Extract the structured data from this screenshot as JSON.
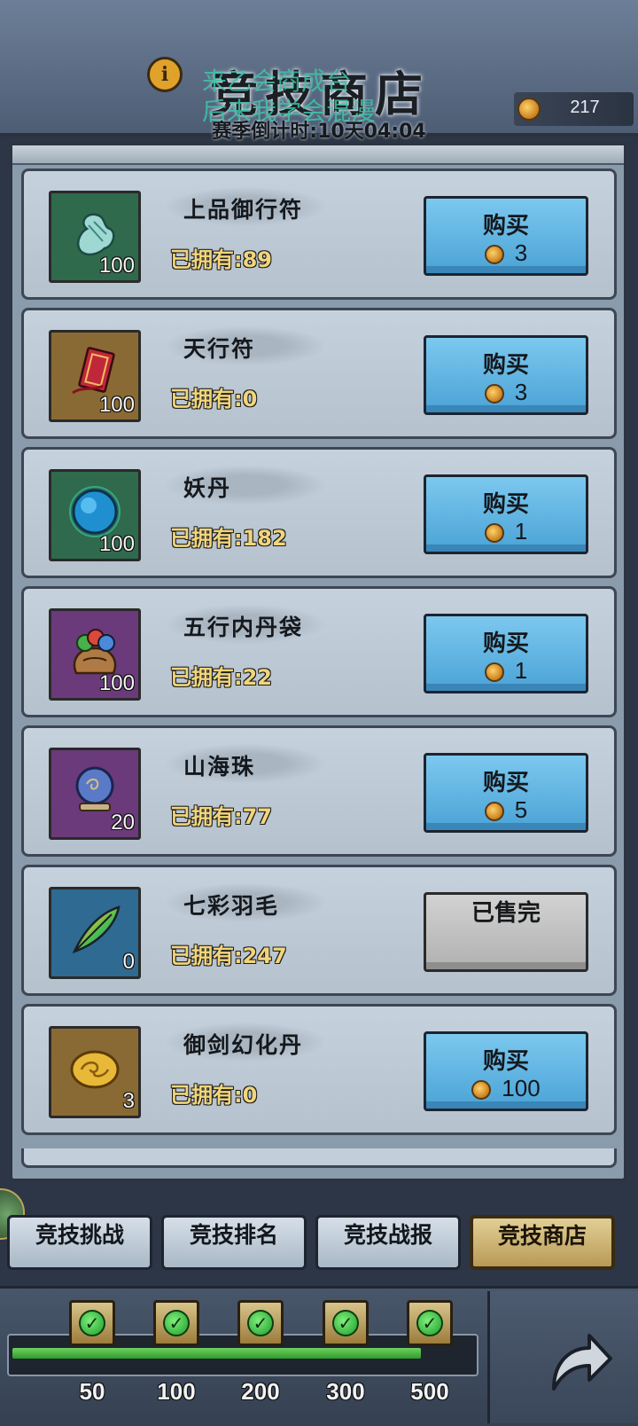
{
  "header": {
    "title": "竞技商店",
    "season_countdown": "赛季倒计时:10天04:04",
    "overlay_line1": "来乙会商成台",
    "overlay_line2": "后来我学会混漫"
  },
  "currency": {
    "icon": "arena-coin-icon",
    "amount": "217"
  },
  "items": [
    {
      "name": "上品御行符",
      "owned": "已拥有:89",
      "count": "100",
      "price": "3",
      "status": "buy",
      "icon": "scroll-talisman-icon",
      "bg": "#2f6a4c"
    },
    {
      "name": "天行符",
      "owned": "已拥有:0",
      "count": "100",
      "price": "3",
      "status": "buy",
      "icon": "red-talisman-icon",
      "bg": "#8a6a34"
    },
    {
      "name": "妖丹",
      "owned": "已拥有:182",
      "count": "100",
      "price": "1",
      "status": "buy",
      "icon": "demon-pill-orb-icon",
      "bg": "#2f6a4c"
    },
    {
      "name": "五行内丹袋",
      "owned": "已拥有:22",
      "count": "100",
      "price": "1",
      "status": "buy",
      "icon": "elixir-bag-icon",
      "bg": "#6a3a7a"
    },
    {
      "name": "山海珠",
      "owned": "已拥有:77",
      "count": "20",
      "price": "5",
      "status": "buy",
      "icon": "crystal-ball-icon",
      "bg": "#6a3a7a"
    },
    {
      "name": "七彩羽毛",
      "owned": "已拥有:247",
      "count": "0",
      "price": "",
      "status": "sold_out",
      "icon": "rainbow-feather-icon",
      "bg": "#2e6a92"
    },
    {
      "name": "御剑幻化丹",
      "owned": "已拥有:0",
      "count": "3",
      "price": "100",
      "status": "buy",
      "icon": "golden-pill-icon",
      "bg": "#8a6a34"
    }
  ],
  "buy_label": "购买",
  "sold_out_label": "已售完",
  "tabs": [
    {
      "label": "竞技挑战",
      "active": false
    },
    {
      "label": "竞技排名",
      "active": false
    },
    {
      "label": "竞技战报",
      "active": false
    },
    {
      "label": "竞技商店",
      "active": true
    }
  ],
  "milestones": {
    "labels": [
      "50",
      "100",
      "200",
      "300",
      "500"
    ],
    "claimed": [
      true,
      true,
      true,
      true,
      true
    ],
    "progress_fraction": 0.88
  },
  "share_icon": "share-arrow-icon"
}
